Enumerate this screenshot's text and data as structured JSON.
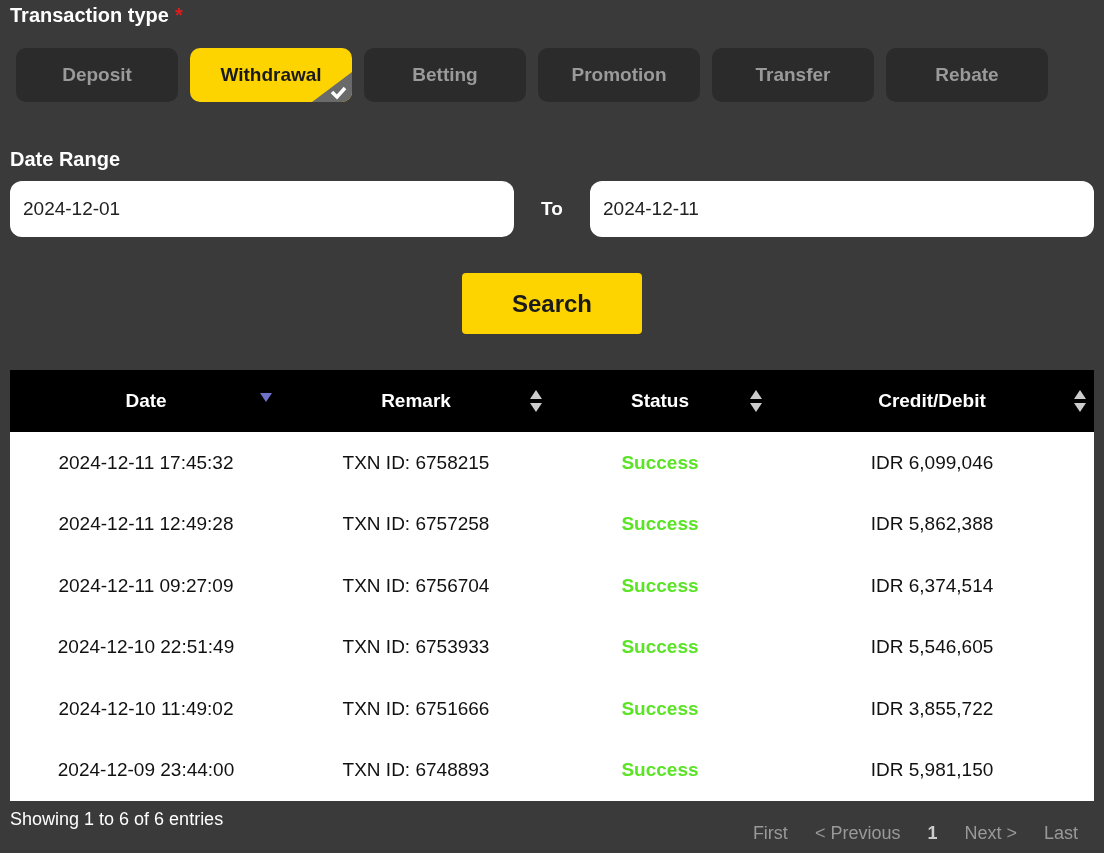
{
  "transaction_type": {
    "label": "Transaction type",
    "required_mark": "*",
    "tabs": [
      {
        "label": "Deposit",
        "selected": false
      },
      {
        "label": "Withdrawal",
        "selected": true
      },
      {
        "label": "Betting",
        "selected": false
      },
      {
        "label": "Promotion",
        "selected": false
      },
      {
        "label": "Transfer",
        "selected": false
      },
      {
        "label": "Rebate",
        "selected": false
      }
    ]
  },
  "date_range": {
    "label": "Date Range",
    "from": "2024-12-01",
    "separator": "To",
    "to": "2024-12-11"
  },
  "search_button": "Search",
  "table": {
    "columns": [
      {
        "label": "Date",
        "sorted": true
      },
      {
        "label": "Remark",
        "sorted": false
      },
      {
        "label": "Status",
        "sorted": false
      },
      {
        "label": "Credit/Debit",
        "sorted": false
      }
    ],
    "rows": [
      {
        "date": "2024-12-11 17:45:32",
        "remark": "TXN ID: 6758215",
        "status": "Success",
        "credit_debit": "IDR 6,099,046"
      },
      {
        "date": "2024-12-11 12:49:28",
        "remark": "TXN ID: 6757258",
        "status": "Success",
        "credit_debit": "IDR 5,862,388"
      },
      {
        "date": "2024-12-11 09:27:09",
        "remark": "TXN ID: 6756704",
        "status": "Success",
        "credit_debit": "IDR 6,374,514"
      },
      {
        "date": "2024-12-10 22:51:49",
        "remark": "TXN ID: 6753933",
        "status": "Success",
        "credit_debit": "IDR 5,546,605"
      },
      {
        "date": "2024-12-10 11:49:02",
        "remark": "TXN ID: 6751666",
        "status": "Success",
        "credit_debit": "IDR 3,855,722"
      },
      {
        "date": "2024-12-09 23:44:00",
        "remark": "TXN ID: 6748893",
        "status": "Success",
        "credit_debit": "IDR 5,981,150"
      }
    ]
  },
  "footer": {
    "info": "Showing 1 to 6 of 6 entries",
    "pagination": [
      {
        "label": "First",
        "selected": false
      },
      {
        "label": "< Previous",
        "selected": false
      },
      {
        "label": "1",
        "selected": true
      },
      {
        "label": "Next >",
        "selected": false
      },
      {
        "label": "Last",
        "selected": false
      }
    ]
  }
}
